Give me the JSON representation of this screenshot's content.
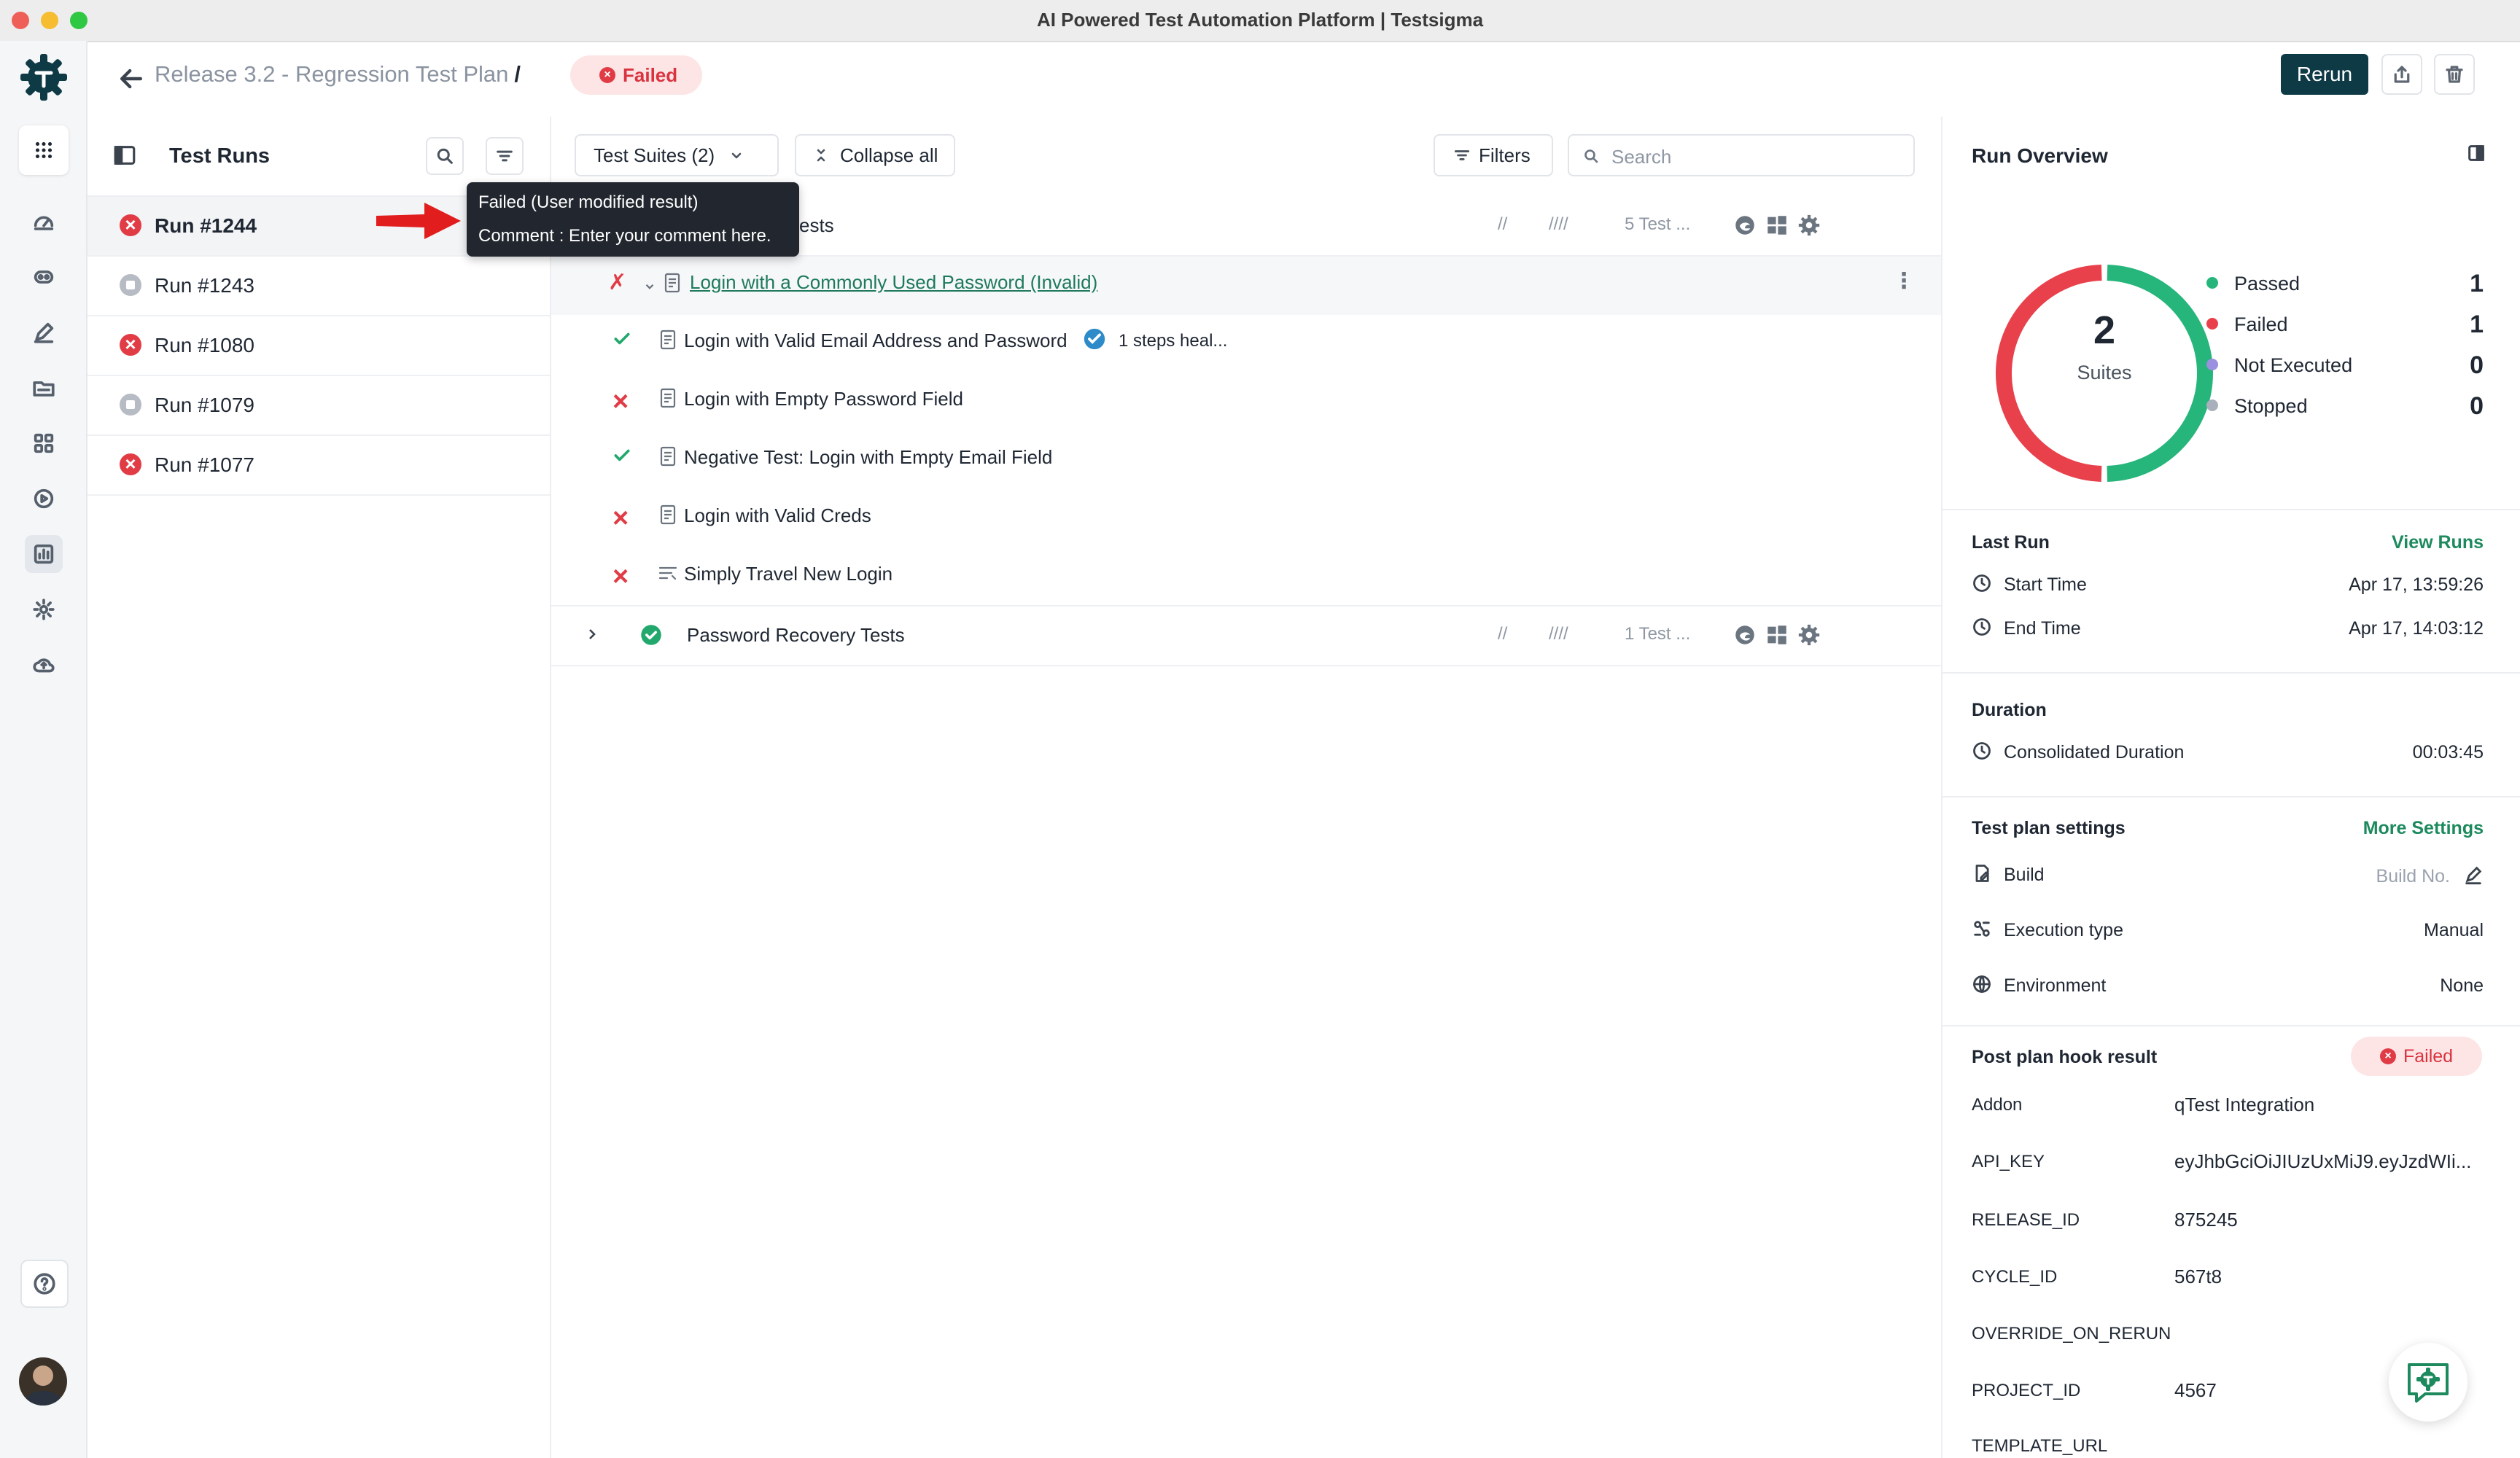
{
  "window": {
    "title": "AI Powered Test Automation Platform | Testsigma"
  },
  "header": {
    "breadcrumb": "Release 3.2 - Regression Test Plan",
    "separator": "/",
    "status": "Failed",
    "rerun_label": "Rerun"
  },
  "runs_panel": {
    "title": "Test Runs",
    "items": [
      {
        "label": "Run #1244",
        "status": "failed"
      },
      {
        "label": "Run #1243",
        "status": "stopped"
      },
      {
        "label": "Run #1080",
        "status": "failed"
      },
      {
        "label": "Run #1079",
        "status": "stopped"
      },
      {
        "label": "Run #1077",
        "status": "failed"
      }
    ]
  },
  "tooltip": {
    "line1": "Failed (User modified result)",
    "line2": "Comment : Enter your comment here."
  },
  "toolbar": {
    "suites_label": "Test Suites (2)",
    "collapse_label": "Collapse all",
    "filters_label": "Filters",
    "search_placeholder": "Search"
  },
  "suites": [
    {
      "name_visible": "ests",
      "stat1": "//",
      "stat2": "////",
      "count": "5 Test ...",
      "cases": [
        {
          "name": "Login with a Commonly Used Password (Invalid)",
          "status": "failed-modified"
        },
        {
          "name": "Login with Valid Email Address and Password",
          "status": "passed",
          "note": "1 steps heal..."
        },
        {
          "name": "Login with Empty Password Field",
          "status": "failed"
        },
        {
          "name": "Negative Test: Login with Empty Email Field",
          "status": "passed"
        },
        {
          "name": "Login with Valid Creds",
          "status": "failed"
        },
        {
          "name": "Simply Travel New Login",
          "status": "failed"
        }
      ]
    },
    {
      "name": "Password Recovery Tests",
      "stat1": "//",
      "stat2": "////",
      "count": "1 Test ..."
    }
  ],
  "overview": {
    "title": "Run Overview",
    "donut": {
      "total": "2",
      "label": "Suites",
      "passed_fraction": 0.5,
      "failed_fraction": 0.5
    },
    "legend": [
      {
        "label": "Passed",
        "value": "1",
        "color": "#26b57a"
      },
      {
        "label": "Failed",
        "value": "1",
        "color": "#e8414b"
      },
      {
        "label": "Not Executed",
        "value": "0",
        "color": "#9b8fe0"
      },
      {
        "label": "Stopped",
        "value": "0",
        "color": "#a9b0bb"
      }
    ],
    "last_run": {
      "title": "Last Run",
      "link": "View Runs",
      "start_label": "Start Time",
      "start_value": "Apr 17, 13:59:26",
      "end_label": "End Time",
      "end_value": "Apr 17, 14:03:12"
    },
    "duration": {
      "title": "Duration",
      "label": "Consolidated Duration",
      "value": "00:03:45"
    },
    "settings": {
      "title": "Test plan settings",
      "link": "More Settings",
      "build_label": "Build",
      "build_placeholder": "Build No.",
      "exec_label": "Execution type",
      "exec_value": "Manual",
      "env_label": "Environment",
      "env_value": "None"
    },
    "hook": {
      "title": "Post plan hook result",
      "status": "Failed",
      "rows": [
        {
          "key": "Addon",
          "value": "qTest Integration"
        },
        {
          "key": "API_KEY",
          "value": "eyJhbGciOiJIUzUxMiJ9.eyJzdWIi..."
        },
        {
          "key": "RELEASE_ID",
          "value": "875245"
        },
        {
          "key": "CYCLE_ID",
          "value": "567t8"
        },
        {
          "key": "OVERRIDE_ON_RERUN",
          "value": ""
        },
        {
          "key": "PROJECT_ID",
          "value": "4567"
        },
        {
          "key": "TEMPLATE_URL",
          "value": ""
        }
      ]
    }
  }
}
